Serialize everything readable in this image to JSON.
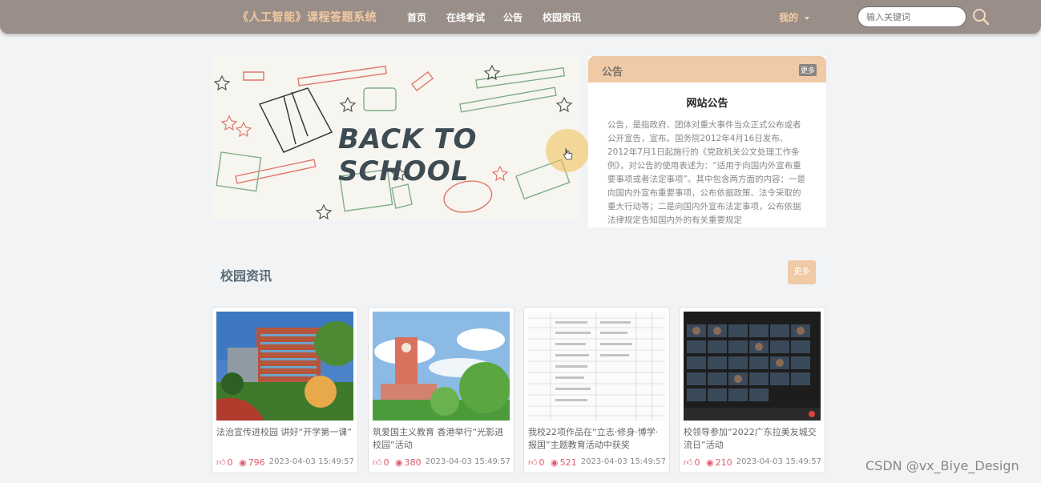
{
  "nav": {
    "brand": "《人工智能》课程答题系统",
    "items": [
      {
        "label": "首页"
      },
      {
        "label": "在线考试"
      },
      {
        "label": "公告"
      },
      {
        "label": "校园资讯"
      }
    ],
    "user_menu": "我的",
    "search_placeholder": "输入关键词"
  },
  "banner": {
    "text": "BACK TO SCHOOL"
  },
  "notice": {
    "title": "公告",
    "more": "更多",
    "heading": "网站公告",
    "body": "公告，是指政府、团体对重大事件当众正式公布或者公开宣告，宣布。国务院2012年4月16日发布、2012年7月1日起施行的《党政机关公文处理工作条例》，对公告的使用表述为：“适用于向国内外宣布重要事项或者法定事项”。其中包含两方面的内容：一是向国内外宣布重要事项，公布依据政策、法令采取的重大行动等；二是向国内外宣布法定事项，公布依据法律规定告知国内外的有关重要规定"
  },
  "news": {
    "title": "校园资讯",
    "more": "更多",
    "cards": [
      {
        "title": "法治宣传进校园 讲好“开学第一课”",
        "likes": "0",
        "views": "796",
        "date": "2023-04-03 15:49:57"
      },
      {
        "title": "筑爱国主义教育 香港举行“光影进校园”活动",
        "likes": "0",
        "views": "380",
        "date": "2023-04-03 15:49:57"
      },
      {
        "title": "我校22项作品在“立志·修身·博学·报国”主题教育活动中获奖",
        "likes": "0",
        "views": "521",
        "date": "2023-04-03 15:49:57"
      },
      {
        "title": "校领导参加“2022广东拉美友城交流日”活动",
        "likes": "0",
        "views": "210",
        "date": "2023-04-03 15:49:57"
      }
    ]
  },
  "watermark": "CSDN @vx_Biye_Design",
  "colors": {
    "nav_bg": "#9a8e88",
    "accent": "#f0c9a7",
    "brand_text": "#f2c9a0",
    "like_red": "#e05a6d"
  }
}
